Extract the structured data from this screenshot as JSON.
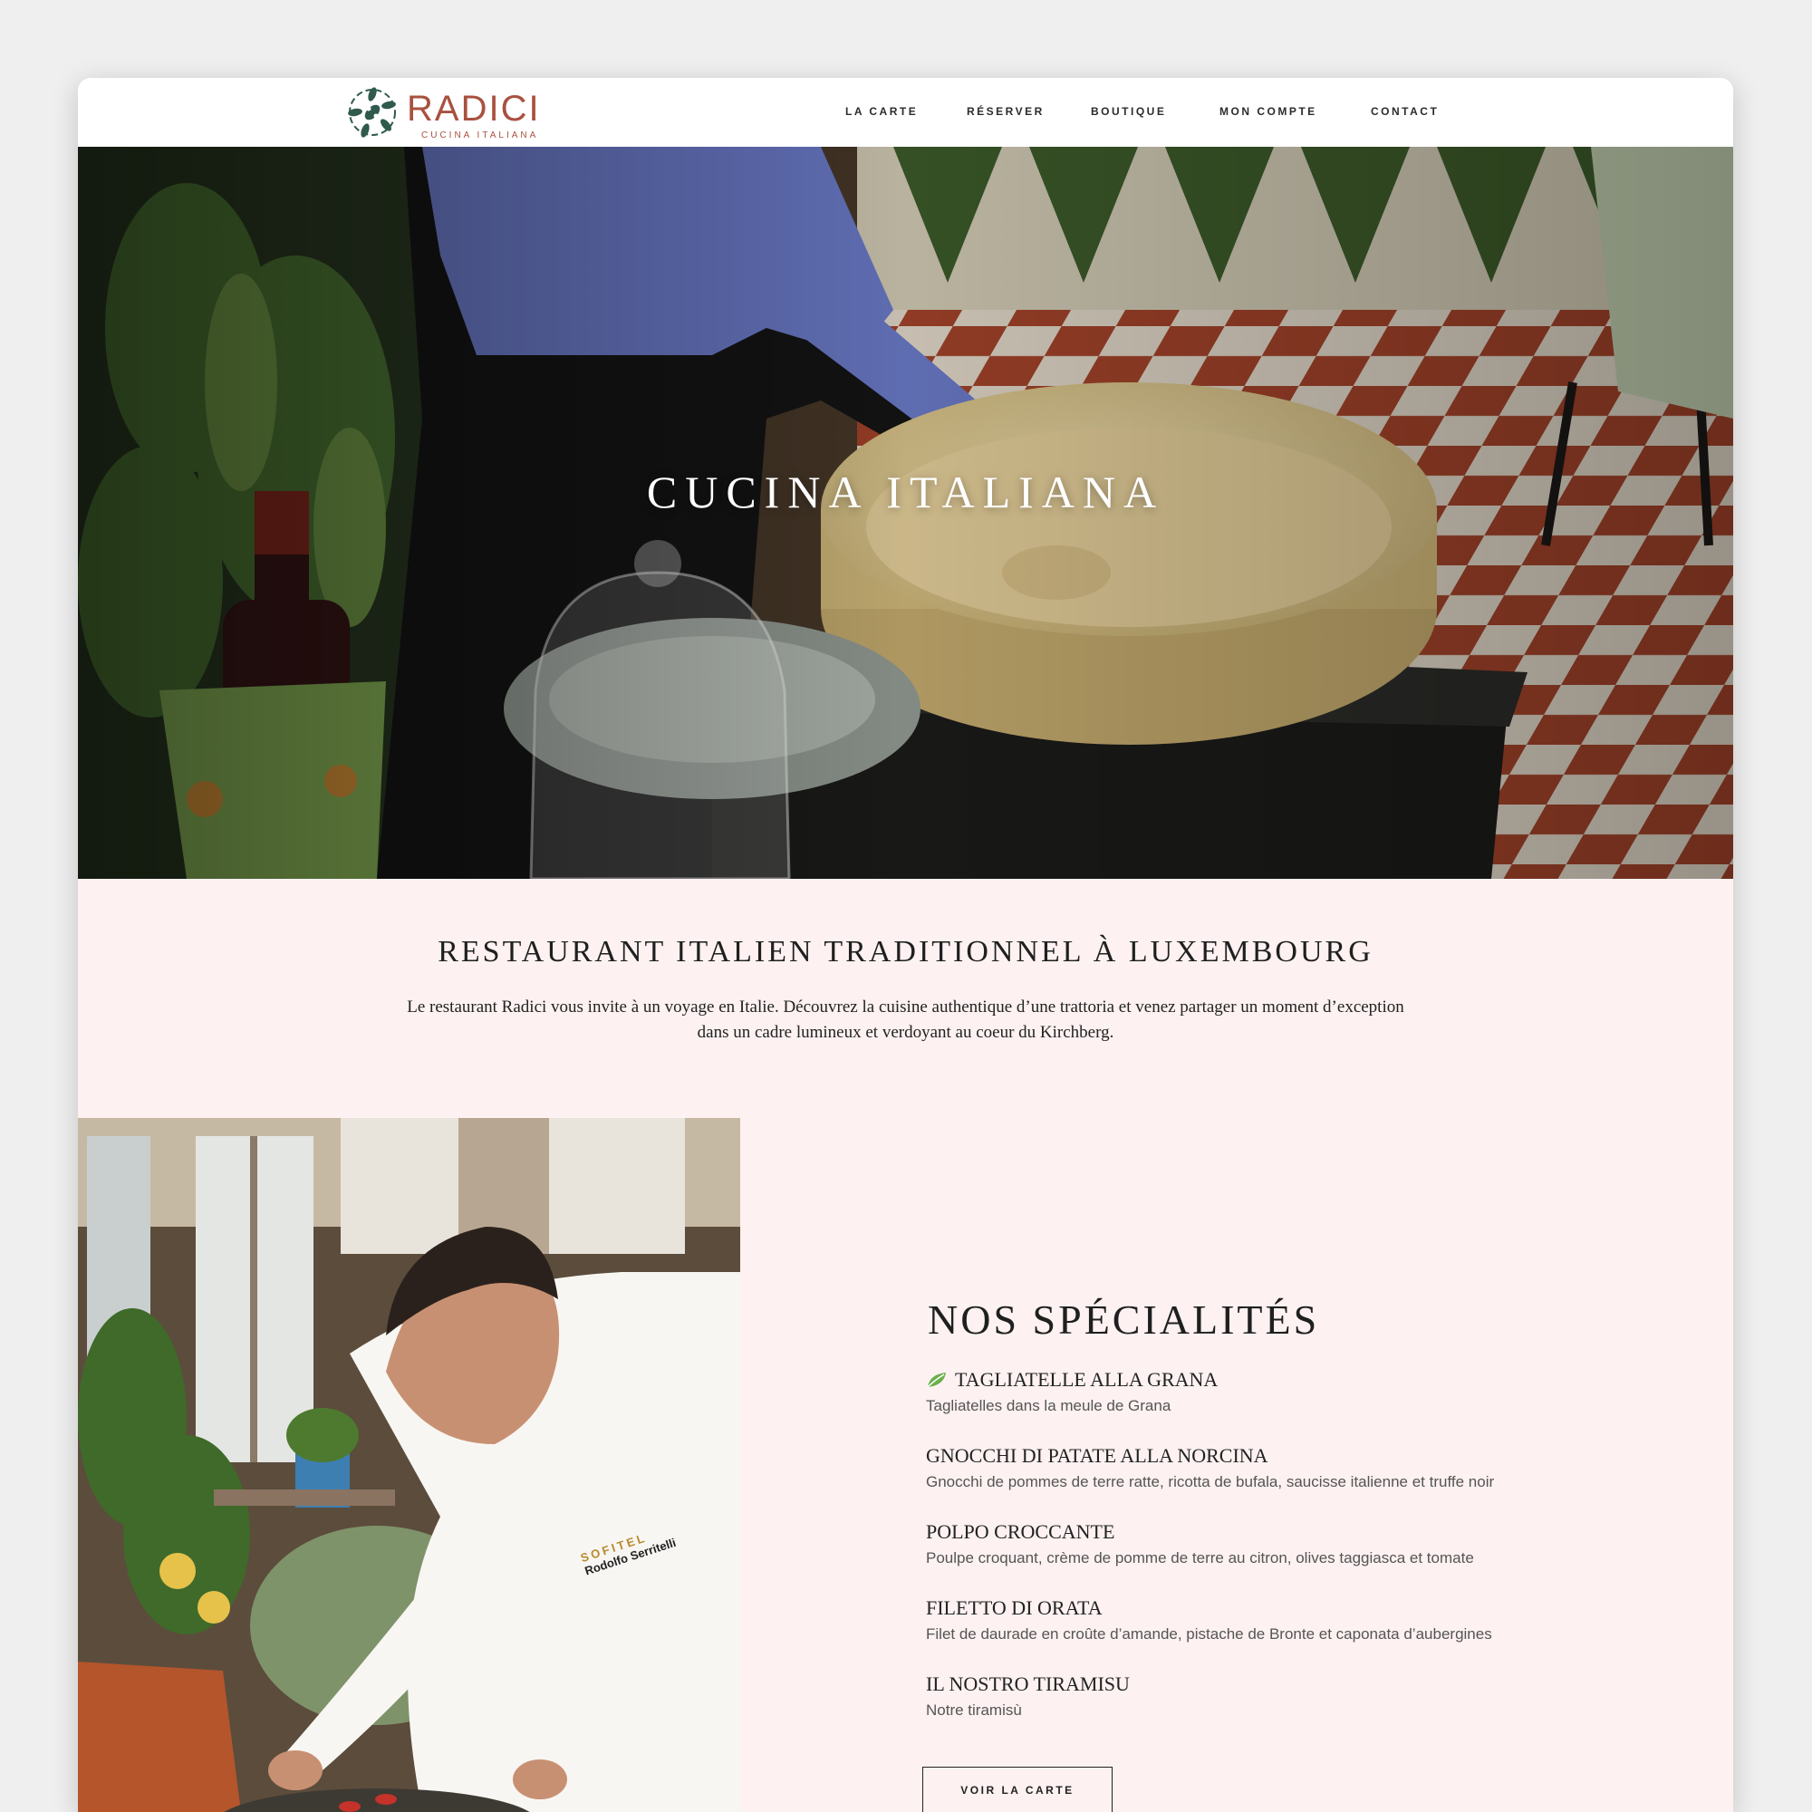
{
  "brand": {
    "name": "RADICI",
    "subtitle": "CUCINA ITALIANA",
    "color": "#a9513f",
    "accent": "#2f5a4d"
  },
  "nav": {
    "items": [
      {
        "label": "LA CARTE"
      },
      {
        "label": "RÉSERVER"
      },
      {
        "label": "BOUTIQUE"
      },
      {
        "label": "MON COMPTE"
      },
      {
        "label": "CONTACT"
      }
    ]
  },
  "hero": {
    "title": "CUCINA ITALIANA"
  },
  "intro": {
    "title": "RESTAURANT ITALIEN TRADITIONNEL À LUXEMBOURG",
    "text_line1": "Le restaurant Radici vous invite à un voyage en Italie. Découvrez la cuisine authentique d’une trattoria et venez partager un moment d’exception",
    "text_line2": "dans un cadre lumineux et verdoyant au coeur du Kirchberg."
  },
  "specialities": {
    "title": "NOS SPÉCIALITÉS",
    "dishes": [
      {
        "name": "TAGLIATELLE ALLA GRANA",
        "description": "Tagliatelles dans la meule de Grana",
        "icon": "leaf-icon"
      },
      {
        "name": "GNOCCHI DI PATATE ALLA NORCINA",
        "description": "Gnocchi de pommes de terre ratte, ricotta de bufala, saucisse italienne et truffe noir"
      },
      {
        "name": "POLPO CROCCANTE",
        "description": "Poulpe croquant, crème de pomme de terre au citron, olives taggiasca et tomate"
      },
      {
        "name": "FILETTO DI ORATA",
        "description": "Filet de daurade en croûte d’amande, pistache de Bronte et caponata d’aubergines"
      },
      {
        "name": "IL NOSTRO TIRAMISU",
        "description": "Notre tiramisù"
      }
    ],
    "cta_label": "VOIR LA CARTE"
  },
  "chef_badge": {
    "brand": "SOFITEL",
    "name": "Rodolfo Serritelli"
  }
}
